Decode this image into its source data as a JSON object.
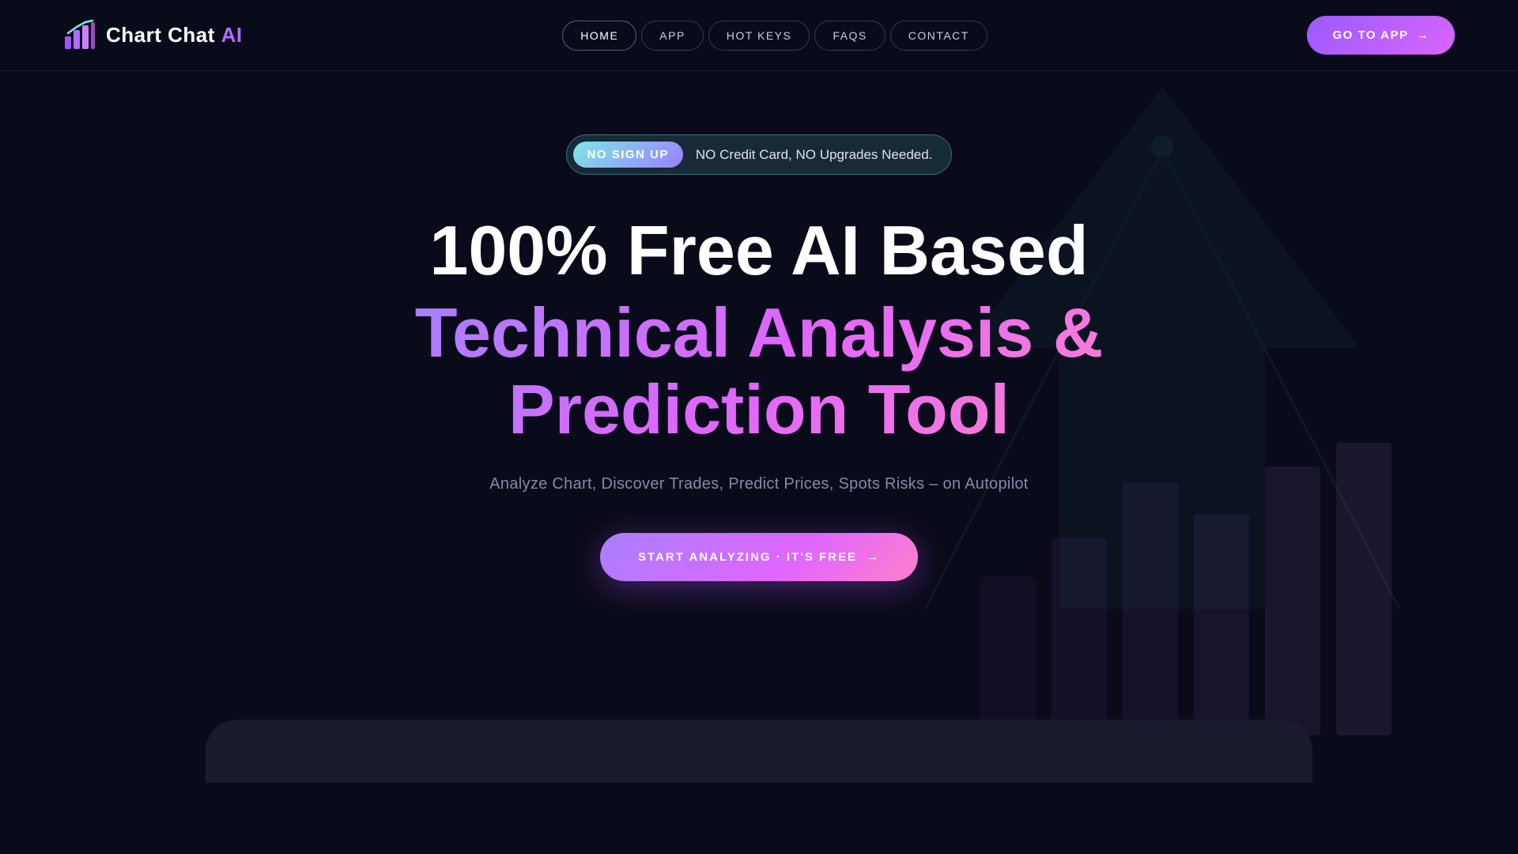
{
  "logo": {
    "text_main": "Chart Chat",
    "text_ai": "AI",
    "icon_label": "chart-chat-logo-icon"
  },
  "nav": {
    "links": [
      {
        "id": "home",
        "label": "HOME",
        "active": true
      },
      {
        "id": "app",
        "label": "APP",
        "active": false
      },
      {
        "id": "hot-keys",
        "label": "HOT KEYS",
        "active": false
      },
      {
        "id": "faqs",
        "label": "FAQS",
        "active": false
      },
      {
        "id": "contact",
        "label": "CONTACT",
        "active": false
      }
    ],
    "cta_label": "GO TO APP",
    "cta_arrow": "→"
  },
  "hero": {
    "badge_label": "NO SIGN UP",
    "badge_text": "NO Credit Card, NO Upgrades Needed.",
    "title_line1": "100% Free AI Based",
    "title_gradient": "Technical Analysis &\nPrediction Tool",
    "subtitle": "Analyze Chart,  Discover Trades, Predict Prices, Spots Risks  – on Autopilot",
    "cta_label": "START ANALYZING · IT'S FREE",
    "cta_arrow": "→"
  }
}
